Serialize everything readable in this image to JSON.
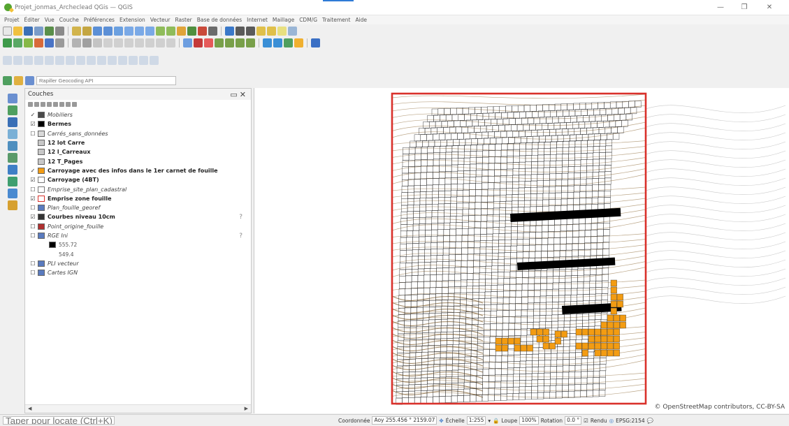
{
  "window": {
    "title": "Projet_jonmas_Archeclead QGis — QGIS",
    "controls": {
      "minimize": "—",
      "maximize": "❐",
      "close": "✕"
    }
  },
  "menu": [
    "Projet",
    "Éditer",
    "Vue",
    "Couche",
    "Préférences",
    "Extension",
    "Vecteur",
    "Raster",
    "Base de données",
    "Internet",
    "Maillage",
    "CDM/G",
    "Traitement",
    "Aide"
  ],
  "locator": {
    "placeholder": "Rapiller Geocoding API"
  },
  "layers_panel": {
    "title": "Couches",
    "items": [
      {
        "name": "Mobiliers",
        "checked": "✓",
        "swatch": "#4a4a4a",
        "style": "italic"
      },
      {
        "name": "Bermes",
        "checked": "☑",
        "swatch": "#000000",
        "style": "bold"
      },
      {
        "name": "Carrés_sans_données",
        "checked": "☐",
        "swatch": "#d9d9d9",
        "style": "italic"
      },
      {
        "name": "12 lot Carre",
        "checked": "",
        "swatch": "#c8c8c8",
        "style": "bold"
      },
      {
        "name": "12 l_Carreaux",
        "checked": "",
        "swatch": "#c8c8c8",
        "style": "bold"
      },
      {
        "name": "12 T_Pages",
        "checked": "",
        "swatch": "#c8c8c8",
        "style": "bold"
      },
      {
        "name": "Carroyage avec des infos dans le 1er carnet de fouille",
        "checked": "✓",
        "swatch": "#f39c12",
        "style": "bold"
      },
      {
        "name": "Carroyage (4BT)",
        "checked": "☑",
        "swatch": "#ffffff",
        "style": "bold"
      },
      {
        "name": "Emprise_site_plan_cadastral",
        "checked": "☐",
        "swatch": "#ffffff",
        "style": "italic"
      },
      {
        "name": "Emprise zone fouille",
        "checked": "☑",
        "swatch": "#ffffff",
        "style": "bold"
      },
      {
        "name": "Plan_fouille_georef",
        "checked": "☐",
        "swatch": "#5a7bbf",
        "style": "italic"
      },
      {
        "name": "Courbes niveau 10cm",
        "checked": "☑",
        "swatch": "#333333",
        "style": "bold"
      },
      {
        "name": "Point_origine_fouille",
        "checked": "☐",
        "swatch": "#b03030",
        "style": "italic"
      },
      {
        "name": "RGE Ini",
        "checked": "☐",
        "swatch": "#5a7bbf",
        "style": "italic"
      },
      {
        "name": "555.72",
        "checked": "",
        "swatch": "#000000",
        "style": "small"
      },
      {
        "name": "549.4",
        "checked": "",
        "swatch": "",
        "style": "small"
      },
      {
        "name": "PLI vecteur",
        "checked": "☐",
        "swatch": "#5a7bbf",
        "style": "italic"
      },
      {
        "name": "Cartes IGN",
        "checked": "☐",
        "swatch": "#5a7bbf",
        "style": "italic"
      }
    ],
    "help_marks": [
      "?",
      "?"
    ]
  },
  "map": {
    "attribution": "© OpenStreetMap contributors, CC-BY-SA",
    "frame_color": "#d9312b",
    "highlight_color": "#f39c12",
    "berme_color": "#000000",
    "contour_color": "#a58a62"
  },
  "status": {
    "search_placeholder": "Taper pour locate (Ctrl+K)",
    "coord_label": "Coordonnée",
    "coord_value": "Aoy 255.456 ° 2159.07",
    "scale_label": "Échelle",
    "scale_value": "1:255",
    "magnifier_label": "Loupe",
    "magnifier_value": "100%",
    "rotation_label": "Rotation",
    "rotation_value": "0.0 °",
    "render_label": "Rendu",
    "crs_value": "EPSG:2154"
  }
}
